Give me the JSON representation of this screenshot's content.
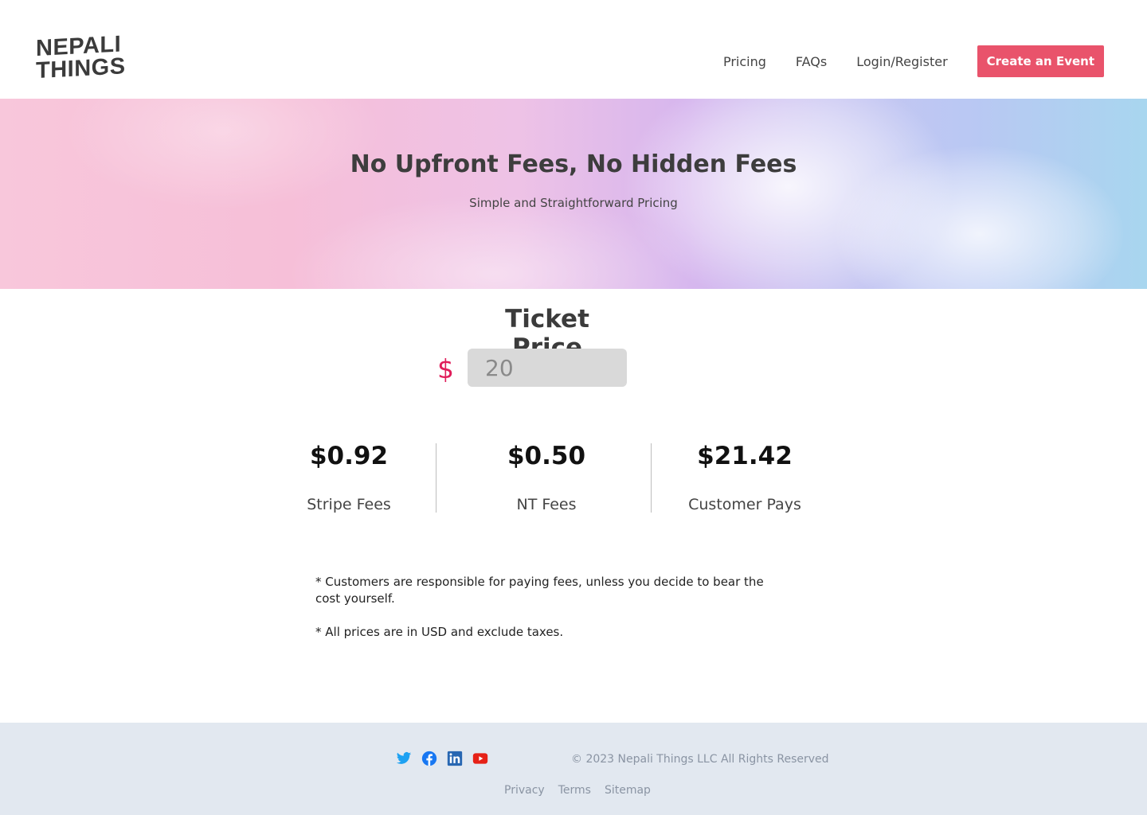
{
  "brand": {
    "line1": "NEPALI",
    "line2": "THINGS"
  },
  "nav": {
    "items": [
      "Pricing",
      "FAQs",
      "Login/Register"
    ],
    "cta_label": "Create an Event"
  },
  "hero": {
    "title": "No Upfront Fees, No Hidden Fees",
    "subtitle": "Simple and Straightforward Pricing"
  },
  "ticket": {
    "title": "Ticket Price",
    "currency_symbol": "$",
    "value": "20"
  },
  "fees": [
    {
      "amount": "$0.92",
      "label": "Stripe Fees"
    },
    {
      "amount": "$0.50",
      "label": "NT Fees"
    },
    {
      "amount": "$21.42",
      "label": "Customer Pays"
    }
  ],
  "notes": [
    "* Customers are responsible for paying fees, unless you decide to bear the cost yourself.",
    "* All prices are in USD and exclude taxes."
  ],
  "footer": {
    "socials": [
      "twitter-icon",
      "facebook-icon",
      "linkedin-icon",
      "youtube-icon"
    ],
    "copyright": "© 2023 Nepali  Things LLC All Rights Reserved",
    "links": [
      "Privacy",
      "Terms",
      "Sitemap"
    ]
  },
  "colors": {
    "accent": "#e9536b",
    "currency": "#e01d5a",
    "footer_bg": "#e2e8f0",
    "twitter": "#1da1f2",
    "facebook": "#1877f2",
    "linkedin": "#2867b2",
    "youtube": "#e62117"
  }
}
